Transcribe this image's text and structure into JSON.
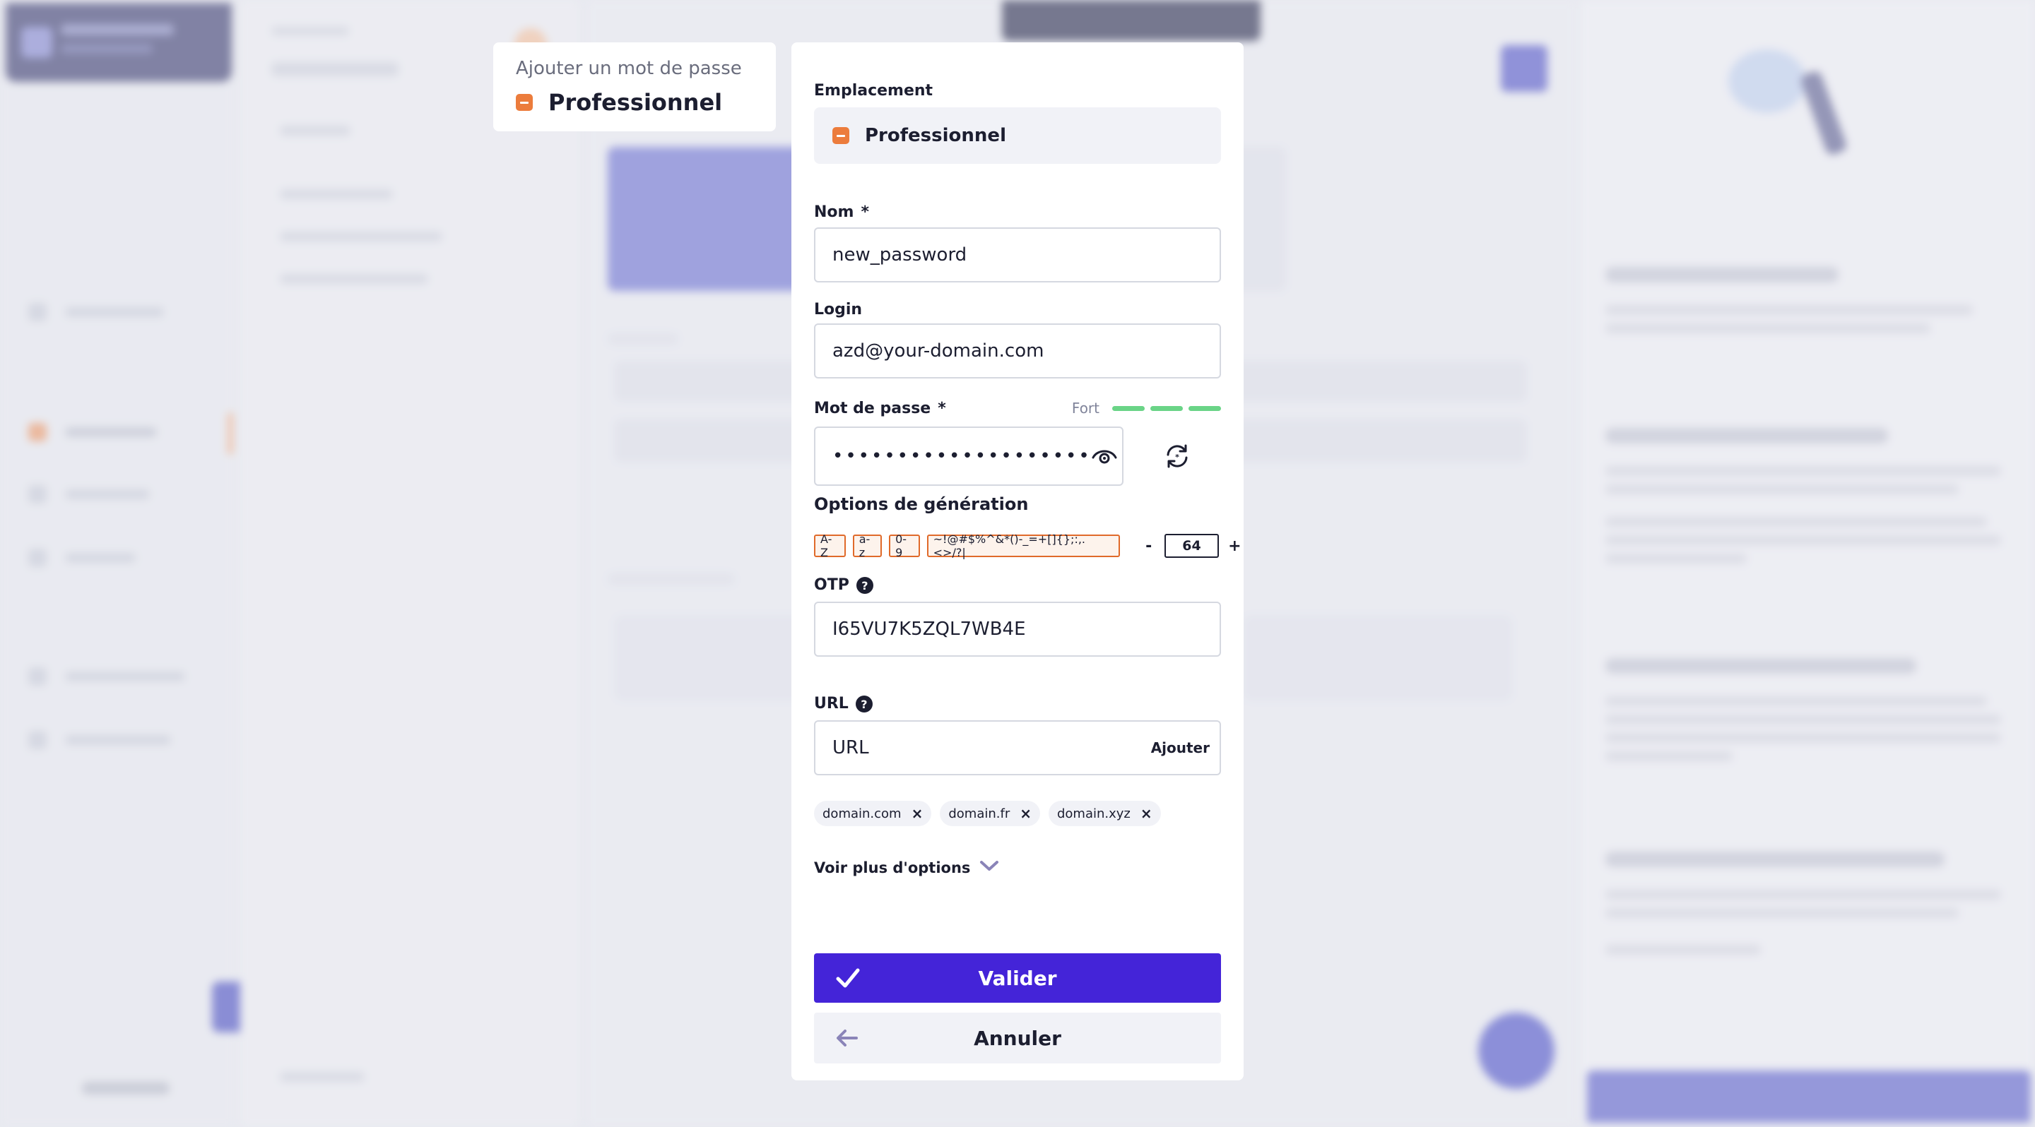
{
  "breadcrumb": {
    "subtitle": "Ajouter un mot de passe",
    "folder": "Professionnel"
  },
  "form": {
    "location": {
      "label": "Emplacement",
      "value": "Professionnel"
    },
    "name": {
      "label": "Nom",
      "required_mark": "*",
      "value": "new_password"
    },
    "login": {
      "label": "Login",
      "value": "azd@your-domain.com"
    },
    "password": {
      "label": "Mot de passe",
      "required_mark": "*",
      "strength_label": "Fort",
      "strength_segments_filled": 3,
      "strength_color": "#6ad487",
      "masked_value": "••••••••••••••••••••"
    },
    "generation": {
      "title": "Options de génération",
      "options": [
        "A-Z",
        "a-z",
        "0-9",
        "~!@#$%^&*()-_=+[]{};:,.<>/?|"
      ],
      "minus": "-",
      "length": "64",
      "plus": "+"
    },
    "otp": {
      "label": "OTP",
      "help": "?",
      "value": "I65VU7K5ZQL7WB4E"
    },
    "url": {
      "label": "URL",
      "help": "?",
      "placeholder": "URL",
      "add_label": "Ajouter",
      "tags": [
        "domain.com",
        "domain.fr",
        "domain.xyz"
      ],
      "tag_remove": "×"
    },
    "more_options": "Voir plus d'options",
    "validate_label": "Valider",
    "cancel_label": "Annuler"
  },
  "colors": {
    "accent": "#4424d8",
    "folder": "#ec7c3c",
    "option_border": "#e06a2a"
  },
  "icons": {
    "folder": "folder-icon",
    "eye": "eye-icon",
    "regenerate": "refresh-icon",
    "help": "help-icon",
    "chevron": "chevron-down-icon",
    "check": "check-icon",
    "back": "arrow-left-icon",
    "close": "close-icon"
  }
}
